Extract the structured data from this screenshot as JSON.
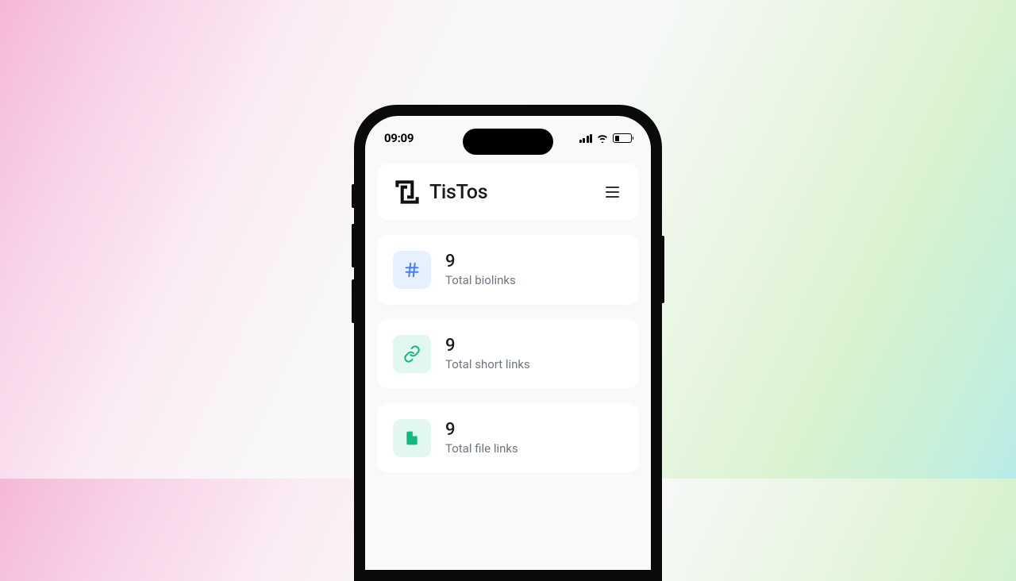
{
  "statusBar": {
    "time": "09:09"
  },
  "header": {
    "brandName": "TisTos"
  },
  "stats": [
    {
      "value": "9",
      "label": "Total biolinks",
      "iconColor": "#4a7cff",
      "iconBg": "blue"
    },
    {
      "value": "9",
      "label": "Total short links",
      "iconColor": "#10b981",
      "iconBg": "green"
    },
    {
      "value": "9",
      "label": "Total file links",
      "iconColor": "#10b981",
      "iconBg": "green"
    }
  ]
}
